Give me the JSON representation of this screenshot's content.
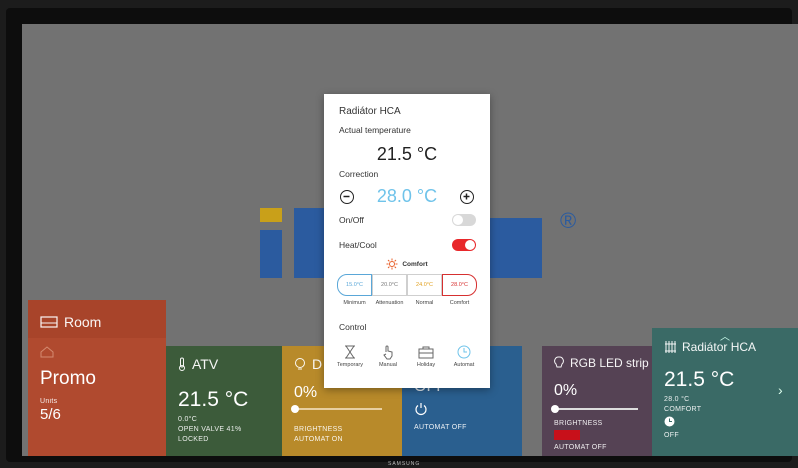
{
  "brand": "SAMSUNG",
  "tiles": {
    "room": {
      "title": "Room",
      "name": "Promo",
      "units_label": "Units",
      "units_value": "5/6"
    },
    "atv": {
      "title": "ATV",
      "temp": "21.5 °C",
      "l1": "0.0°C",
      "l2": "OPEN VALVE 41%",
      "l3": "LOCKED"
    },
    "dimmer": {
      "title": "D",
      "value": "0%",
      "l1": "BRIGHTNESS",
      "l2": "AUTOMAT ON"
    },
    "blue": {
      "value": "OFF",
      "l1": "AUTOMAT OFF"
    },
    "rgb": {
      "title": "RGB LED strip",
      "value": "0%",
      "l1": "BRIGHTNESS",
      "l2": "AUTOMAT OFF",
      "swatch": "#c8101a"
    },
    "hca": {
      "title": "Radiátor HCA",
      "temp": "21.5 °C",
      "l1": "28.0 °C",
      "l2": "COMFORT",
      "l3": "OFF"
    }
  },
  "modal": {
    "title": "Radiátor HCA",
    "actual_label": "Actual temperature",
    "actual_value": "21.5 °C",
    "correction_label": "Correction",
    "correction_value": "28.0 °C",
    "onoff_label": "On/Off",
    "onoff_state": "off",
    "heatcool_label": "Heat/Cool",
    "heatcool_state": "on",
    "mode_label": "Comfort",
    "modes": [
      {
        "temp": "15.0°C",
        "name": "Minimum",
        "color": "#5aa7d8"
      },
      {
        "temp": "20.0°C",
        "name": "Attenuation",
        "color": "#777777"
      },
      {
        "temp": "24.0°C",
        "name": "Normal",
        "color": "#e0a020"
      },
      {
        "temp": "28.0°C",
        "name": "Comfort",
        "color": "#d63030"
      }
    ],
    "control_label": "Control",
    "controls": [
      {
        "name": "Temporary",
        "icon": "hourglass-icon"
      },
      {
        "name": "Manual",
        "icon": "hand-icon"
      },
      {
        "name": "Holiday",
        "icon": "suitcase-icon"
      },
      {
        "name": "Automat",
        "icon": "clock-icon"
      }
    ],
    "accent": "#6fc3ea",
    "toggle_on_color": "#e8282b"
  }
}
